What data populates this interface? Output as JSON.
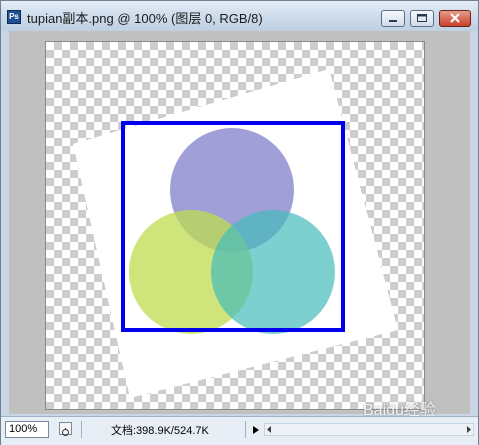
{
  "window": {
    "title": "tupian副本.png @ 100% (图层 0, RGB/8)",
    "app_icon_label": "Ps",
    "app_icon": "photoshop-document-icon",
    "controls": {
      "minimize_icon": "minimize-icon",
      "maximize_icon": "maximize-icon",
      "close_icon": "close-icon"
    }
  },
  "document": {
    "transparency_pattern": "checkerboard",
    "colors": {
      "rotated_square": "#ffffff",
      "frame_border": "#0000ee",
      "circle_top": "#8f8ed0",
      "circle_left": "#c7e06a",
      "circle_right": "#6ccac8"
    }
  },
  "status": {
    "zoom": "100%",
    "doc_info": "文档:398.9K/524.7K",
    "nav_icon": "navigator-icon",
    "arrow_icon": "play-arrow-icon"
  },
  "watermark": "Baidu经验"
}
